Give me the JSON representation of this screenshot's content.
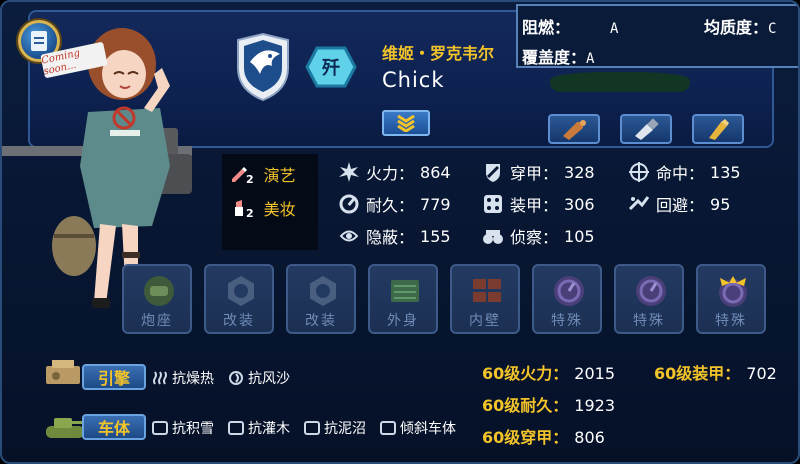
{
  "header": {
    "sign_text": "Coming soon...",
    "name_cn": "维姬・罗克韦尔",
    "name_en": "Chick",
    "class_glyph": "歼",
    "emblem": "eagle-shield-icon",
    "rank": "chevron-rank-icon"
  },
  "traits": {
    "flame_label": "阻燃：",
    "flame_value": "A",
    "uniform_label": "均质度：",
    "uniform_value": "C",
    "coverage_label": "覆盖度：",
    "coverage_value": "A"
  },
  "equipment_buttons": [
    "shell-icon",
    "flashlight-icon",
    "ammo-icon"
  ],
  "skills": [
    {
      "level": "2",
      "name": "演艺",
      "icon": "pencil-icon"
    },
    {
      "level": "2",
      "name": "美妆",
      "icon": "lipstick-icon"
    }
  ],
  "stats": {
    "firepower": {
      "label": "火力：",
      "value": "864"
    },
    "durability": {
      "label": "耐久：",
      "value": "779"
    },
    "stealth": {
      "label": "隐蔽：",
      "value": "155"
    },
    "penetration": {
      "label": "穿甲：",
      "value": "328"
    },
    "armor": {
      "label": "装甲：",
      "value": "306"
    },
    "recon": {
      "label": "侦察：",
      "value": "105"
    },
    "accuracy": {
      "label": "命中：",
      "value": "135"
    },
    "evasion": {
      "label": "回避：",
      "value": "95"
    }
  },
  "slots": [
    {
      "label": "炮座",
      "icon": "turret-slot-icon"
    },
    {
      "label": "改装",
      "icon": "hex-nut-icon"
    },
    {
      "label": "改装",
      "icon": "hex-nut-icon"
    },
    {
      "label": "外身",
      "icon": "hull-panel-icon"
    },
    {
      "label": "内壁",
      "icon": "brick-wall-icon"
    },
    {
      "label": "特殊",
      "icon": "gauge-icon"
    },
    {
      "label": "特殊",
      "icon": "gauge-icon"
    },
    {
      "label": "特殊",
      "icon": "gauge-wings-icon"
    }
  ],
  "engine": {
    "label": "引擎",
    "perks": [
      {
        "name": "抗燥热",
        "icon": "heat-waves-icon"
      },
      {
        "name": "抗风沙",
        "icon": "wind-swirl-icon"
      }
    ]
  },
  "body": {
    "label": "车体",
    "perks": [
      {
        "name": "抗积雪",
        "icon": "snow-track-icon"
      },
      {
        "name": "抗灌木",
        "icon": "shrub-track-icon"
      },
      {
        "name": "抗泥沼",
        "icon": "mud-track-icon"
      },
      {
        "name": "倾斜车体",
        "icon": "tilt-hull-icon"
      }
    ]
  },
  "level60": {
    "firepower": {
      "label": "60级火力：",
      "value": "2015"
    },
    "armor": {
      "label": "60级装甲：",
      "value": "702"
    },
    "durability": {
      "label": "60级耐久：",
      "value": "1923"
    },
    "penetration": {
      "label": "60级穿甲：",
      "value": "806"
    }
  },
  "colors": {
    "accent_gold": "#f3c32a",
    "panel_blue": "#13295a",
    "border_blue": "#2f5895"
  }
}
